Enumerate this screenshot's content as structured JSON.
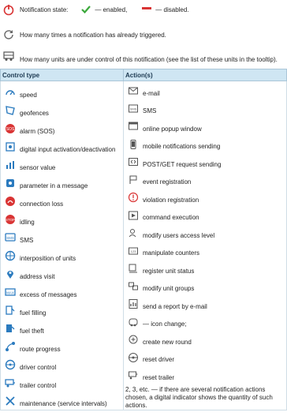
{
  "legend": {
    "state_label": "Notification state:",
    "enabled_text": "— enabled,",
    "disabled_text": "— disabled.",
    "trigger_text": "How many times a notification has already triggered.",
    "units_text": "How many units are under control of this notification (see the list of these units in the tooltip)."
  },
  "table": {
    "headers": [
      "Control type",
      "Action(s)"
    ],
    "control_types": [
      {
        "label": "speed",
        "icon": "speedometer-icon"
      },
      {
        "label": "geofences",
        "icon": "geofence-icon"
      },
      {
        "label": "alarm (SOS)",
        "icon": "sos-icon"
      },
      {
        "label": "digital input activation/deactivation",
        "icon": "digital-input-icon"
      },
      {
        "label": "sensor value",
        "icon": "sensor-icon"
      },
      {
        "label": "parameter in a message",
        "icon": "parameter-icon"
      },
      {
        "label": "connection loss",
        "icon": "connection-loss-icon"
      },
      {
        "label": "idling",
        "icon": "idling-icon"
      },
      {
        "label": "SMS",
        "icon": "sms-icon"
      },
      {
        "label": "interposition of units",
        "icon": "interposition-icon"
      },
      {
        "label": "address visit",
        "icon": "location-pin-icon"
      },
      {
        "label": "excess of messages",
        "icon": "messages-icon"
      },
      {
        "label": "fuel filling",
        "icon": "fuel-filling-icon"
      },
      {
        "label": "fuel theft",
        "icon": "fuel-theft-icon"
      },
      {
        "label": "route progress",
        "icon": "route-icon"
      },
      {
        "label": "driver control",
        "icon": "driver-icon"
      },
      {
        "label": "trailer control",
        "icon": "trailer-icon"
      },
      {
        "label": "maintenance (service intervals)",
        "icon": "maintenance-icon"
      }
    ],
    "actions": [
      {
        "label": "e-mail",
        "icon": "envelope-icon"
      },
      {
        "label": "SMS",
        "icon": "sms-action-icon"
      },
      {
        "label": "online popup window",
        "icon": "popup-window-icon"
      },
      {
        "label": "mobile notifications sending",
        "icon": "mobile-icon"
      },
      {
        "label": "POST/GET request sending",
        "icon": "request-icon"
      },
      {
        "label": "event registration",
        "icon": "flag-icon"
      },
      {
        "label": "violation registration",
        "icon": "violation-icon"
      },
      {
        "label": "command execution",
        "icon": "command-icon"
      },
      {
        "label": "modify users access level",
        "icon": "user-access-icon"
      },
      {
        "label": "manipulate counters",
        "icon": "counters-icon"
      },
      {
        "label": "register unit status",
        "icon": "unit-status-icon"
      },
      {
        "label": "modify unit groups",
        "icon": "unit-groups-icon"
      },
      {
        "label": "send a report by e-mail",
        "icon": "report-icon"
      },
      {
        "label": "— icon change;",
        "icon": "icon-change-icon"
      },
      {
        "label": "create new round",
        "icon": "new-round-icon"
      },
      {
        "label": "reset driver",
        "icon": "reset-driver-icon"
      },
      {
        "label": "reset trailer",
        "icon": "reset-trailer-icon"
      }
    ],
    "note": "2, 3, etc. — if there are several notification actions chosen, a digital indicator shows the quantity of such actions."
  },
  "colors": {
    "header_bg": "#cfe6f3",
    "icon_blue": "#2b7bbf",
    "enabled": "#3aa83a",
    "disabled": "#d93434",
    "icon_gray": "#555555"
  }
}
